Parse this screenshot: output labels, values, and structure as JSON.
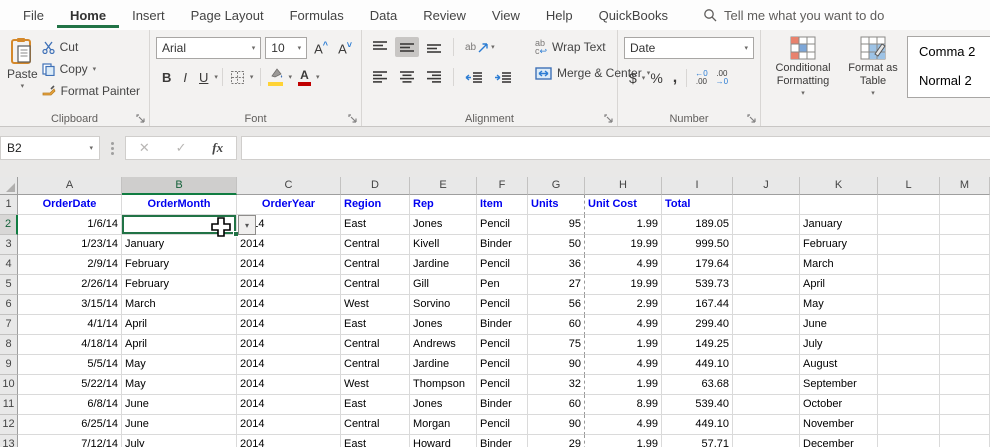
{
  "colors": {
    "accent_green": "#217346",
    "selected_header_green": "#107c41",
    "header_text_blue": "#0000f0",
    "font_color_red": "#c00000",
    "fill_yellow": "#ffd335"
  },
  "icons": {
    "caret": "▾",
    "search": "magnifier",
    "select_all": "corner-triangle",
    "cell_cursor": "plus-cursor",
    "validation_dropdown": "▾"
  },
  "menu": {
    "tabs": [
      "File",
      "Home",
      "Insert",
      "Page Layout",
      "Formulas",
      "Data",
      "Review",
      "View",
      "Help",
      "QuickBooks"
    ],
    "active": "Home",
    "search": "Tell me what you want to do"
  },
  "ribbon": {
    "clipboard": {
      "title": "Clipboard",
      "paste": "Paste",
      "cut": "Cut",
      "copy": "Copy",
      "format_painter": "Format Painter"
    },
    "font": {
      "title": "Font",
      "family": "Arial",
      "size": "10",
      "bold": "B",
      "italic": "I",
      "underline": "U",
      "letter": "A"
    },
    "alignment": {
      "title": "Alignment",
      "wrap": "Wrap Text",
      "merge": "Merge & Center"
    },
    "number": {
      "title": "Number",
      "format": "Date",
      "currency": "$",
      "percent": "%",
      "comma": ",",
      "inc_top": "←0",
      "inc_bottom": ".00",
      "dec_top": ".00",
      "dec_bottom": "→0"
    },
    "styles": {
      "conditional_formatting": "Conditional Formatting",
      "format_as_table": "Format as Table",
      "gallery": [
        "Comma 2",
        "Normal 2"
      ]
    }
  },
  "formula_bar": {
    "name_box": "B2",
    "cancel": "✕",
    "enter": "✓",
    "fx": "fx",
    "formula": ""
  },
  "sheet": {
    "col_letters": [
      "A",
      "B",
      "C",
      "D",
      "E",
      "F",
      "G",
      "H",
      "I",
      "J",
      "K",
      "L",
      "M"
    ],
    "active_cell": "B2",
    "selected_column": "B",
    "selected_row": "2",
    "rows": [
      {
        "n": "1",
        "cells": {
          "A": "OrderDate",
          "B": "OrderMonth",
          "C": "OrderYear",
          "D": "Region",
          "E": "Rep",
          "F": "Item",
          "G": "Units",
          "H": "Unit Cost",
          "I": "Total"
        }
      },
      {
        "n": "2",
        "cells": {
          "A": "1/6/14",
          "B": "",
          "C": "2014",
          "D": "East",
          "E": "Jones",
          "F": "Pencil",
          "G": "95",
          "H": "1.99",
          "I": "189.05",
          "K": "January"
        }
      },
      {
        "n": "3",
        "cells": {
          "A": "1/23/14",
          "B": "January",
          "C": "2014",
          "D": "Central",
          "E": "Kivell",
          "F": "Binder",
          "G": "50",
          "H": "19.99",
          "I": "999.50",
          "K": "February"
        }
      },
      {
        "n": "4",
        "cells": {
          "A": "2/9/14",
          "B": "February",
          "C": "2014",
          "D": "Central",
          "E": "Jardine",
          "F": "Pencil",
          "G": "36",
          "H": "4.99",
          "I": "179.64",
          "K": "March"
        }
      },
      {
        "n": "5",
        "cells": {
          "A": "2/26/14",
          "B": "February",
          "C": "2014",
          "D": "Central",
          "E": "Gill",
          "F": "Pen",
          "G": "27",
          "H": "19.99",
          "I": "539.73",
          "K": "April"
        }
      },
      {
        "n": "6",
        "cells": {
          "A": "3/15/14",
          "B": "March",
          "C": "2014",
          "D": "West",
          "E": "Sorvino",
          "F": "Pencil",
          "G": "56",
          "H": "2.99",
          "I": "167.44",
          "K": "May"
        }
      },
      {
        "n": "7",
        "cells": {
          "A": "4/1/14",
          "B": "April",
          "C": "2014",
          "D": "East",
          "E": "Jones",
          "F": "Binder",
          "G": "60",
          "H": "4.99",
          "I": "299.40",
          "K": "June"
        }
      },
      {
        "n": "8",
        "cells": {
          "A": "4/18/14",
          "B": "April",
          "C": "2014",
          "D": "Central",
          "E": "Andrews",
          "F": "Pencil",
          "G": "75",
          "H": "1.99",
          "I": "149.25",
          "K": "July"
        }
      },
      {
        "n": "9",
        "cells": {
          "A": "5/5/14",
          "B": "May",
          "C": "2014",
          "D": "Central",
          "E": "Jardine",
          "F": "Pencil",
          "G": "90",
          "H": "4.99",
          "I": "449.10",
          "K": "August"
        }
      },
      {
        "n": "10",
        "cells": {
          "A": "5/22/14",
          "B": "May",
          "C": "2014",
          "D": "West",
          "E": "Thompson",
          "F": "Pencil",
          "G": "32",
          "H": "1.99",
          "I": "63.68",
          "K": "September"
        }
      },
      {
        "n": "11",
        "cells": {
          "A": "6/8/14",
          "B": "June",
          "C": "2014",
          "D": "East",
          "E": "Jones",
          "F": "Binder",
          "G": "60",
          "H": "8.99",
          "I": "539.40",
          "K": "October"
        }
      },
      {
        "n": "12",
        "cells": {
          "A": "6/25/14",
          "B": "June",
          "C": "2014",
          "D": "Central",
          "E": "Morgan",
          "F": "Pencil",
          "G": "90",
          "H": "4.99",
          "I": "449.10",
          "K": "November"
        }
      },
      {
        "n": "13",
        "cells": {
          "A": "7/12/14",
          "B": "July",
          "C": "2014",
          "D": "East",
          "E": "Howard",
          "F": "Binder",
          "G": "29",
          "H": "1.99",
          "I": "57.71",
          "K": "December"
        }
      }
    ]
  }
}
